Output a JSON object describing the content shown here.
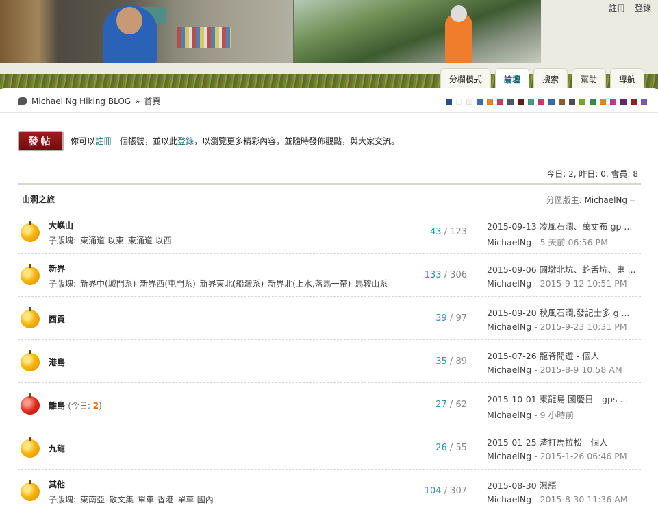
{
  "header": {
    "links": [
      "註冊",
      "登錄"
    ],
    "tabs": [
      {
        "label": "分欄模式",
        "active": false
      },
      {
        "label": "論壇",
        "active": true
      },
      {
        "label": "搜索",
        "active": false
      },
      {
        "label": "幫助",
        "active": false
      },
      {
        "label": "導航",
        "active": false
      }
    ]
  },
  "breadcrumb": {
    "site": "Michael Ng Hiking BLOG",
    "sep": "»",
    "current": "首頁"
  },
  "swatch_colors": [
    "#2a4f8f",
    "#ffffff",
    "#f1f1f1",
    "#3d6fae",
    "#e58a1e",
    "#c9405c",
    "#4f5a68",
    "#6a1b1b",
    "#4a9a88",
    "#d03a6a",
    "#3a6ab5",
    "#8a5f30",
    "#4a4f57",
    "#7aa82a",
    "#3a8a55",
    "#e8861c",
    "#c23a8f",
    "#5c2c6e",
    "#9a1d1d",
    "#7a5ab6"
  ],
  "post_button": "發帖",
  "notice": {
    "pre": "你可以",
    "register": "註冊",
    "mid": "一個帳號，並以此",
    "login": "登錄",
    "post": "，以瀏覽更多精彩內容，並隨時發佈觀點，與大家交流。"
  },
  "stats": "今日: 2, 昨日: 0, 會員: 8",
  "forum": {
    "title": "山澗之旅",
    "moderator_label": "分區版主:",
    "moderator": "MichaelNg",
    "boards": [
      {
        "name": "大嶼山",
        "today": "",
        "sub_label": "子版塊:",
        "subs": [
          "東涌道 以東",
          "東涌道 以西"
        ],
        "threads": "43",
        "posts": "123",
        "last_title": "2015-09-13 凌風石澗、萬丈布 gp ...",
        "last_user": "MichaelNg",
        "last_time": "5 天前 06:56 PM",
        "icon": "yellow"
      },
      {
        "name": "新界",
        "today": "",
        "sub_label": "子版塊:",
        "subs": [
          "新界中(城門系)",
          "新界西(屯門系)",
          "新界東北(船灣系)",
          "新界北(上水,落馬一帶)",
          "馬鞍山系"
        ],
        "threads": "133",
        "posts": "306",
        "last_title": "2015-09-06 圓墩北坑、蛇舌坑、鬼 ...",
        "last_user": "MichaelNg",
        "last_time": "2015-9-12 10:51 PM",
        "icon": "yellow"
      },
      {
        "name": "西貢",
        "today": "",
        "sub_label": "",
        "subs": [],
        "threads": "39",
        "posts": "97",
        "last_title": "2015-09-20 秋風石澗,發記士多 g ...",
        "last_user": "MichaelNg",
        "last_time": "2015-9-23 10:31 PM",
        "icon": "yellow"
      },
      {
        "name": "港島",
        "today": "",
        "sub_label": "",
        "subs": [],
        "threads": "35",
        "posts": "89",
        "last_title": "2015-07-26 龍脊閒遊 - 個人",
        "last_user": "MichaelNg",
        "last_time": "2015-8-9 10:58 AM",
        "icon": "yellow"
      },
      {
        "name": "離島",
        "today_label": "今日:",
        "today": "2",
        "sub_label": "",
        "subs": [],
        "threads": "27",
        "posts": "62",
        "last_title": "2015-10-01 東龍島 國慶日 - gps ...",
        "last_user": "MichaelNg",
        "last_time": "9 小時前",
        "icon": "red"
      },
      {
        "name": "九龍",
        "today": "",
        "sub_label": "",
        "subs": [],
        "threads": "26",
        "posts": "55",
        "last_title": "2015-01-25 渣打馬拉松 - 個人",
        "last_user": "MichaelNg",
        "last_time": "2015-1-26 06:46 PM",
        "icon": "yellow"
      },
      {
        "name": "其他",
        "today": "",
        "sub_label": "子版塊:",
        "subs": [
          "東南亞",
          "散文集",
          "單車-香港",
          "單車-國內"
        ],
        "threads": "104",
        "posts": "307",
        "last_title": "2015-08-30 濕語",
        "last_user": "MichaelNg",
        "last_time": "2015-8-30 11:36 AM",
        "icon": "yellow"
      }
    ]
  }
}
